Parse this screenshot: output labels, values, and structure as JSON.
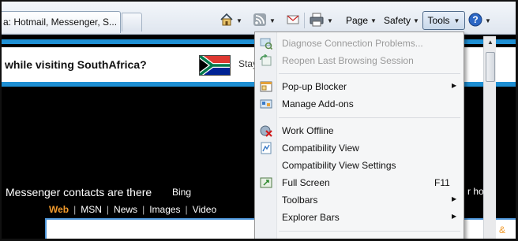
{
  "tab": {
    "title": "a: Hotmail, Messenger, S..."
  },
  "toolbar": {
    "page_label": "Page",
    "safety_label": "Safety",
    "tools_label": "Tools"
  },
  "page": {
    "banner_text": "while visiting SouthAfrica?",
    "banner_cta": "Stay",
    "messenger_text": "Messenger contacts are there",
    "bing_label": "Bing",
    "right_text": "r ho",
    "nav": [
      "Web",
      "MSN",
      "News",
      "Images",
      "Video"
    ],
    "right_box_text": "&"
  },
  "menu": {
    "items": [
      {
        "label": "Diagnose Connection Problems...",
        "disabled": true,
        "icon": "diagnose-icon"
      },
      {
        "label": "Reopen Last Browsing Session",
        "disabled": true,
        "icon": "reopen-session-icon"
      },
      {
        "label": "Pop-up Blocker",
        "submenu": true,
        "icon": "popup-blocker-icon"
      },
      {
        "label": "Manage Add-ons",
        "icon": "addons-icon"
      },
      {
        "label": "Work Offline",
        "icon": "work-offline-icon"
      },
      {
        "label": "Compatibility View",
        "icon": "compatibility-view-icon"
      },
      {
        "label": "Compatibility View Settings"
      },
      {
        "label": "Full Screen",
        "shortcut": "F11",
        "icon": "full-screen-icon"
      },
      {
        "label": "Toolbars",
        "submenu": true
      },
      {
        "label": "Explorer Bars",
        "submenu": true
      }
    ]
  },
  "colors": {
    "accent_stripe": "#1e8fd3",
    "nav_active": "#f19a2c"
  }
}
